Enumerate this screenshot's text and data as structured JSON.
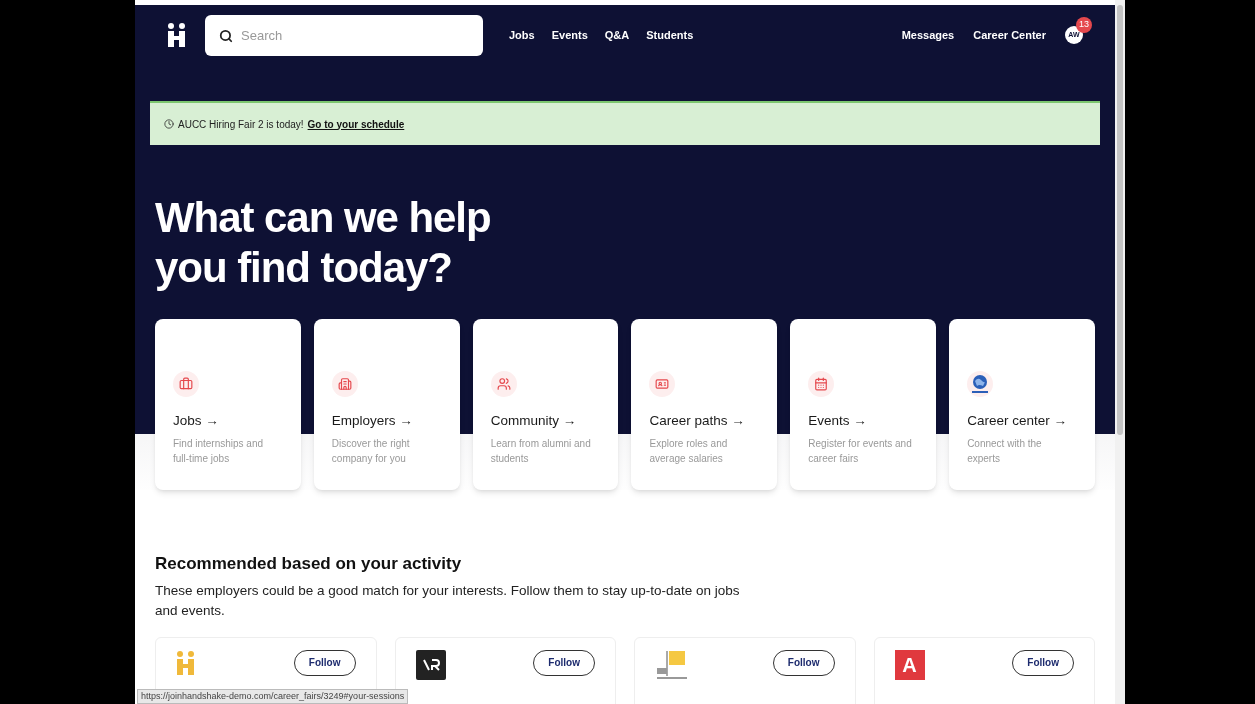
{
  "header": {
    "search": {
      "placeholder": "Search"
    },
    "nav": [
      {
        "label": "Jobs"
      },
      {
        "label": "Events"
      },
      {
        "label": "Q&A"
      },
      {
        "label": "Students"
      }
    ],
    "right_links": [
      {
        "label": "Messages"
      },
      {
        "label": "Career Center"
      }
    ],
    "avatar": {
      "initials": "AW",
      "badge": "13"
    }
  },
  "banner": {
    "text": "AUCC Hiring Fair 2 is today!",
    "link": "Go to your schedule"
  },
  "hero": {
    "title_lines": [
      "What can we help",
      "you find today?"
    ]
  },
  "categories": [
    {
      "kind": "briefcase",
      "title": "Jobs →",
      "description": "Find internships and full-time jobs"
    },
    {
      "kind": "building",
      "title": "Employers →",
      "description": "Discover the right company for you"
    },
    {
      "kind": "people",
      "title": "Community →",
      "description": "Learn from alumni and students"
    },
    {
      "kind": "paths",
      "title": "Career paths →",
      "description": "Explore roles and average salaries"
    },
    {
      "kind": "calendar",
      "title": "Events →",
      "description": "Register for events and career fairs"
    },
    {
      "kind": "globe",
      "title": "Career center →",
      "description": "Connect with the experts"
    }
  ],
  "recommended": {
    "title": "Recommended based on your activity",
    "description": "These employers could be a good match for your interests. Follow them to stay up-to-date on jobs and events.",
    "employers": [
      {
        "kind": "handshake",
        "follow": "Follow"
      },
      {
        "kind": "dark-square",
        "follow": "Follow"
      },
      {
        "kind": "flag",
        "follow": "Follow"
      },
      {
        "kind": "letter",
        "logo_text": "A",
        "follow": "Follow"
      }
    ]
  },
  "status_bar": {
    "url": "https://joinhandshake-demo.com/career_fairs/3249#your-sessions"
  }
}
